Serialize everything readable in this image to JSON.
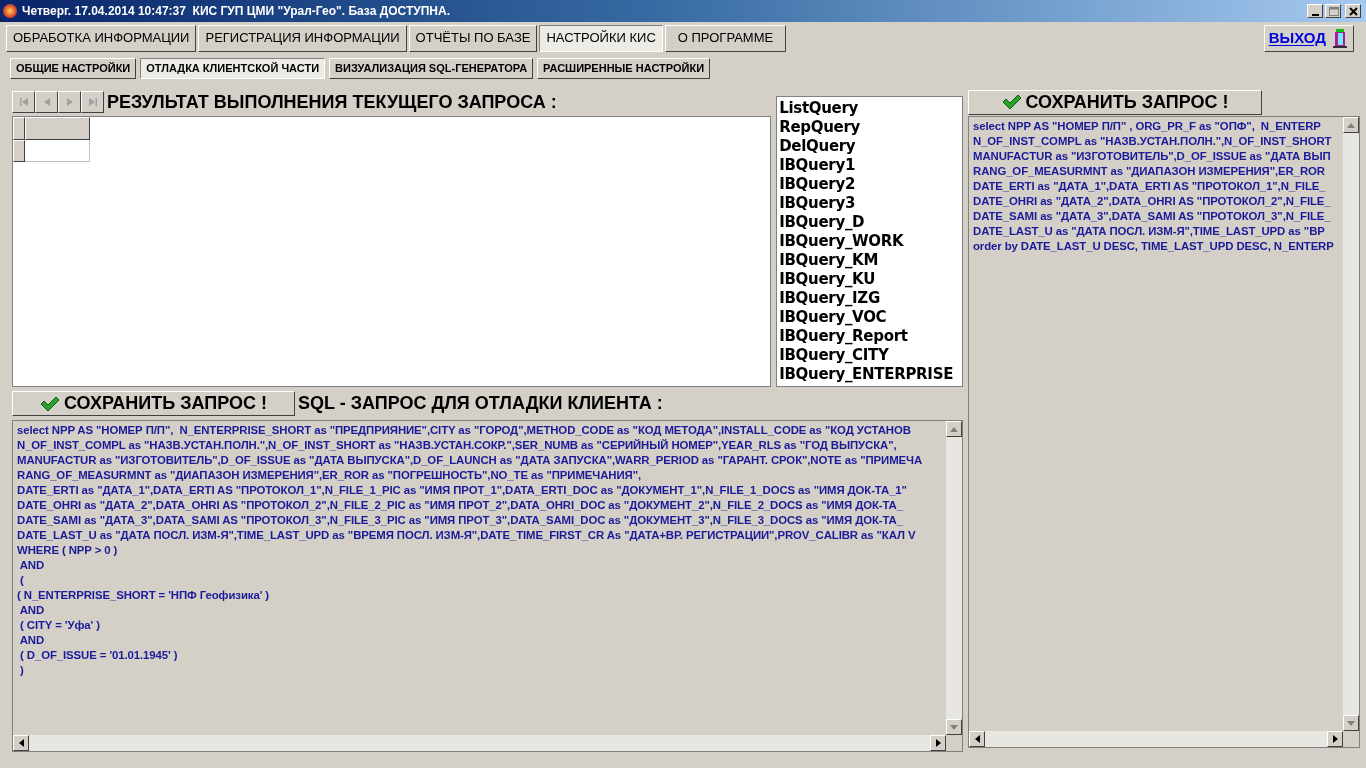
{
  "window": {
    "title": "Четверг. 17.04.2014 10:47:37  КИС ГУП ЦМИ \"Урал-Гео\". База ДОСТУПНА."
  },
  "main_tabs": [
    {
      "label": "ОБРАБОТКА ИНФОРМАЦИИ",
      "selected": false
    },
    {
      "label": "РЕГИСТРАЦИЯ ИНФОРМАЦИИ",
      "selected": false
    },
    {
      "label": "ОТЧЁТЫ ПО БАЗЕ",
      "selected": false
    },
    {
      "label": "НАСТРОЙКИ КИС",
      "selected": true
    },
    {
      "label": "О ПРОГРАММЕ",
      "selected": false
    }
  ],
  "exit_button": {
    "label": "ВЫХОД"
  },
  "sub_tabs": [
    {
      "label": "ОБЩИЕ НАСТРОЙКИ",
      "selected": false
    },
    {
      "label": "ОТЛАДКА КЛИЕНТСКОЙ ЧАСТИ",
      "selected": true
    },
    {
      "label": "ВИЗУАЛИЗАЦИЯ SQL-ГЕНЕРАТОРА",
      "selected": false
    },
    {
      "label": "РАСШИРЕННЫЕ НАСТРОЙКИ",
      "selected": false
    }
  ],
  "navigator": [
    {
      "kind": "first",
      "disabled": true
    },
    {
      "kind": "prior",
      "disabled": true
    },
    {
      "kind": "next",
      "disabled": true
    },
    {
      "kind": "last",
      "disabled": true
    }
  ],
  "result_heading": "РЕЗУЛЬТАТ ВЫПОЛНЕНИЯ ТЕКУЩЕГО ЗАПРОСА :",
  "query_list": [
    "ListQuery",
    "RepQuery",
    "DelQuery",
    "IBQuery1",
    "IBQuery2",
    "IBQuery3",
    "IBQuery_D",
    "IBQuery_WORK",
    "IBQuery_KM",
    "IBQuery_KU",
    "IBQuery_IZG",
    "IBQuery_VOC",
    "IBQuery_Report",
    "IBQuery_CITY",
    "IBQuery_ENTERPRISE"
  ],
  "right_save_button": "СОХРАНИТЬ ЗАПРОС !",
  "right_editor": [
    "select NPP AS \"НОМЕР П/П\" , ORG_PR_F as \"ОПФ\",  N_ENTERP",
    "N_OF_INST_COMPL as \"НАЗВ.УСТАН.ПОЛН.\",N_OF_INST_SHORT",
    "MANUFACTUR as \"ИЗГОТОВИТЕЛЬ\",D_OF_ISSUE as \"ДАТА ВЫП",
    "RANG_OF_MEASURMNT as \"ДИАПАЗОН ИЗМЕРЕНИЯ\",ER_ROR",
    "DATE_ERTI as \"ДАТА_1\",DATA_ERTI AS \"ПРОТОКОЛ_1\",N_FILE_",
    "DATE_OHRI as \"ДАТА_2\",DATA_OHRI AS \"ПРОТОКОЛ_2\",N_FILE_",
    "DATE_SAMI as \"ДАТА_3\",DATA_SAMI AS \"ПРОТОКОЛ_3\",N_FILE_",
    "DATE_LAST_U as \"ДАТА ПОСЛ. ИЗМ-Я\",TIME_LAST_UPD as \"ВР",
    "order by DATE_LAST_U DESC, TIME_LAST_UPD DESC, N_ENTERP"
  ],
  "debug_save_button": "СОХРАНИТЬ ЗАПРОС !",
  "debug_heading": "SQL - ЗАПРОС ДЛЯ ОТЛАДКИ КЛИЕНТА :",
  "debug_editor": [
    "select NPP AS \"НОМЕР П/П\",  N_ENTERPRISE_SHORT as \"ПРЕДПРИЯНИЕ\",CITY as \"ГОРОД\",METHOD_CODE as \"КОД МЕТОДА\",INSTALL_CODE as \"КОД УСТАНОВ",
    "N_OF_INST_COMPL as \"НАЗВ.УСТАН.ПОЛН.\",N_OF_INST_SHORT as \"НАЗВ.УСТАН.СОКР.\",SER_NUMB as \"СЕРИЙНЫЙ НОМЕР\",YEAR_RLS as \"ГОД ВЫПУСКА\",",
    "MANUFACTUR as \"ИЗГОТОВИТЕЛЬ\",D_OF_ISSUE as \"ДАТА ВЫПУСКА\",D_OF_LAUNCH as \"ДАТА ЗАПУСКА\",WARR_PERIOD as \"ГАРАНТ. СРОК\",NOTE as \"ПРИМЕЧА",
    "RANG_OF_MEASURMNT as \"ДИАПАЗОН ИЗМЕРЕНИЯ\",ER_ROR as \"ПОГРЕШНОСТЬ\",NO_TE as \"ПРИМЕЧАНИЯ\",",
    "DATE_ERTI as \"ДАТА_1\",DATA_ERTI AS \"ПРОТОКОЛ_1\",N_FILE_1_PIC as \"ИМЯ ПРОТ_1\",DATA_ERTI_DOC as \"ДОКУМЕНТ_1\",N_FILE_1_DOCS as \"ИМЯ ДОК-ТА_1\"",
    "DATE_OHRI as \"ДАТА_2\",DATA_OHRI AS \"ПРОТОКОЛ_2\",N_FILE_2_PIC as \"ИМЯ ПРОТ_2\",DATA_OHRI_DOC as \"ДОКУМЕНТ_2\",N_FILE_2_DOCS as \"ИМЯ ДОК-ТА_",
    "DATE_SAMI as \"ДАТА_3\",DATA_SAMI AS \"ПРОТОКОЛ_3\",N_FILE_3_PIC as \"ИМЯ ПРОТ_3\",DATA_SAMI_DOC as \"ДОКУМЕНТ_3\",N_FILE_3_DOCS as \"ИМЯ ДОК-ТА_",
    "DATE_LAST_U as \"ДАТА ПОСЛ. ИЗМ-Я\",TIME_LAST_UPD as \"ВРЕМЯ ПОСЛ. ИЗМ-Я\",DATE_TIME_FIRST_CR As \"ДАТА+ВР. РЕГИСТРАЦИИ\",PROV_CALIBR as \"КАЛ V",
    "WHERE ( NPP > 0 )",
    " AND",
    " (",
    "( N_ENTERPRISE_SHORT = 'НПФ Геофизика' )",
    " AND",
    " ( CITY = 'Уфа' )",
    " AND",
    " ( D_OF_ISSUE = '01.01.1945' )",
    " )"
  ]
}
